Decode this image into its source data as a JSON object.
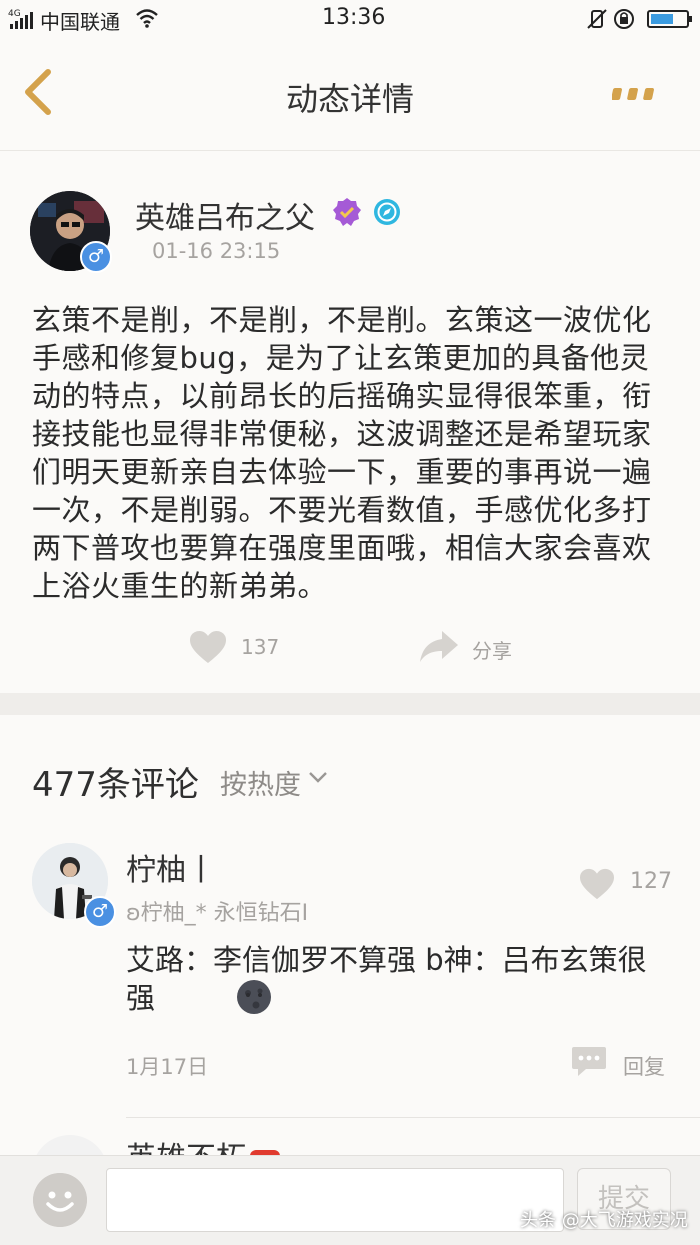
{
  "status_bar": {
    "network": "4G",
    "carrier": "中国联通",
    "time": "13:36"
  },
  "header": {
    "title": "动态详情"
  },
  "post": {
    "author_name": "英雄吕布之父",
    "timestamp": "01-16 23:15",
    "body": "玄策不是削，不是削，不是削。玄策这一波优化手感和修复bug，是为了让玄策更加的具备他灵动的特点，以前昂长的后摇确实显得很笨重，衔接技能也显得非常便秘，这波调整还是希望玩家们明天更新亲自去体验一下，重要的事再说一遍一次，不是削弱。不要光看数值，手感优化多打两下普攻也要算在强度里面哦，相信大家会喜欢上浴火重生的新弟弟。",
    "like_count": "137",
    "share_label": "分享"
  },
  "comments": {
    "count_label": "477条评论",
    "sort_label": "按热度",
    "items": [
      {
        "name": "柠柚丨",
        "sub": "ʚ柠柚_* 永恒钻石I",
        "like_count": "127",
        "text": "艾路：李信伽罗不算强 b神：吕布玄策很强",
        "date": "1月17日",
        "reply_label": "回复"
      },
      {
        "name": "英雄不朽"
      }
    ]
  },
  "bottom_bar": {
    "input_placeholder": "",
    "submit_label": "提交"
  },
  "watermark": "头条 @大飞游戏实况",
  "colors": {
    "accent": "#d4a24c",
    "gender_blue": "#4a90e2",
    "verified_purple": "#a55ad6",
    "badge_cyan": "#2fb7e0"
  }
}
